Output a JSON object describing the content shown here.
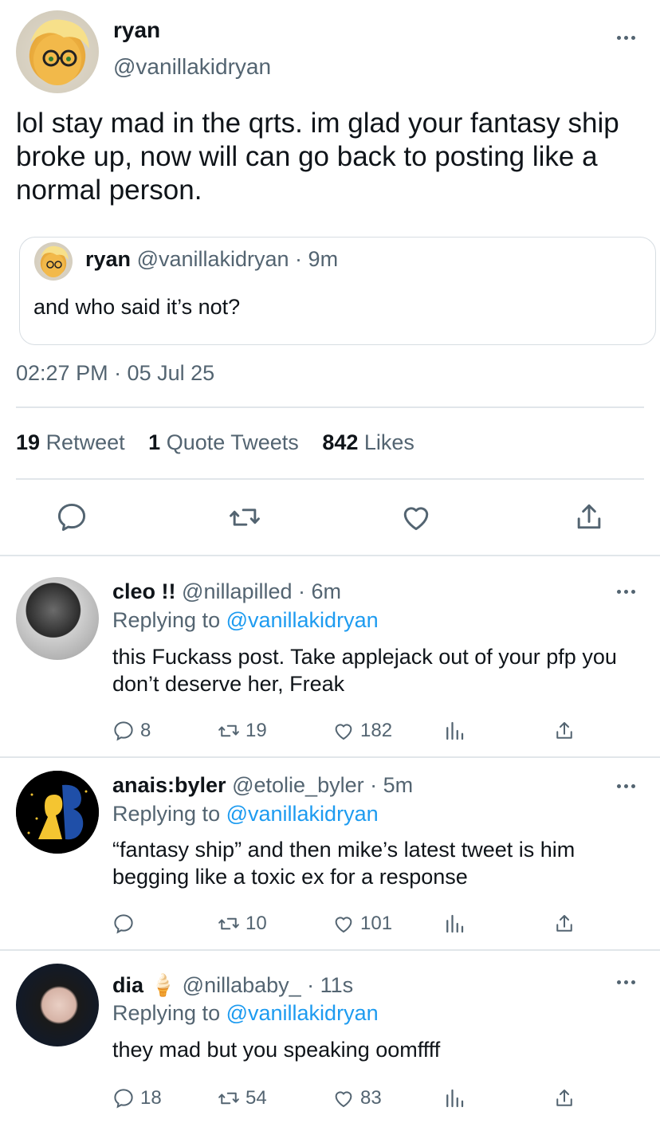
{
  "main": {
    "name": "ryan",
    "handle": "@vanillakidryan",
    "text": "lol stay mad in the qrts. im glad your fantasy ship broke up, now will can go back to posting like a normal person.",
    "quote": {
      "name": "ryan",
      "meta": "@vanillakidryan · 9m",
      "text": "and who said it’s not?"
    },
    "timestamp": "02:27 PM · 05 Jul 25",
    "stats": {
      "retweets": "19",
      "retweets_label": "Retweet",
      "quotes": "1",
      "quotes_label": "Quote Tweets",
      "likes": "842",
      "likes_label": "Likes"
    }
  },
  "replies": [
    {
      "name": "cleo !!",
      "meta": "@nillapilled · 6m",
      "replying_prefix": "Replying to",
      "replying_handle": "@vanillakidryan",
      "text": "this Fuckass post. Take applejack out of your pfp you don’t deserve her, Freak",
      "replies": "8",
      "retweets": "19",
      "likes": "182"
    },
    {
      "name": "anais:byler",
      "meta": "@etolie_byler · 5m",
      "replying_prefix": "Replying to",
      "replying_handle": "@vanillakidryan",
      "text": "“fantasy ship” and then mike’s latest tweet is him begging like a toxic ex for a response",
      "replies": "",
      "retweets": "10",
      "likes": "101"
    },
    {
      "name": "dia 🍦",
      "meta": "@nillababy_ · 11s",
      "replying_prefix": "Replying to",
      "replying_handle": "@vanillakidryan",
      "text": "they mad but you speaking oomffff",
      "replies": "18",
      "retweets": "54",
      "likes": "83"
    }
  ],
  "icons": {
    "reply": "reply-icon",
    "retweet": "retweet-icon",
    "like": "heart-icon",
    "share": "share-icon",
    "analytics": "analytics-icon",
    "more": "more-icon"
  },
  "colors": {
    "link": "#1d9bf0",
    "muted": "#536471",
    "text": "#0f1419",
    "divider": "#e1e6ea"
  }
}
